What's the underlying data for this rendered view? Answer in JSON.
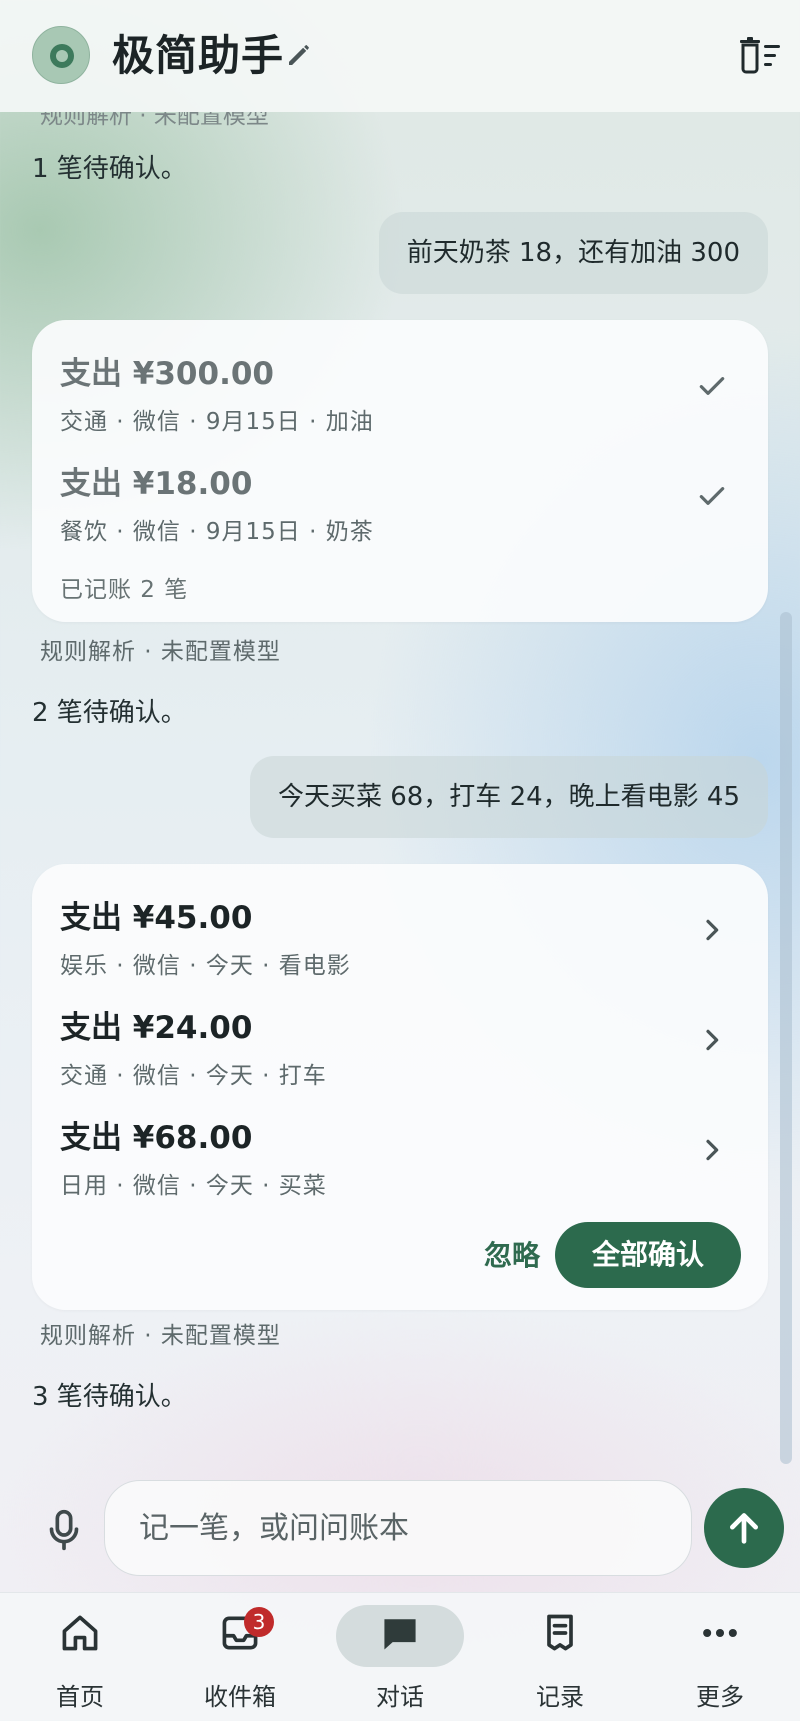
{
  "header": {
    "title": "极简助手"
  },
  "chat": {
    "peek_text": "规则解析 · 未配置模型",
    "messages": [
      {
        "type": "assistant_text",
        "text": "1 笔待确认。"
      },
      {
        "type": "user",
        "text": "前天奶茶 18，还有加油 300"
      },
      {
        "type": "card",
        "entries": [
          {
            "amount": "支出 ¥300.00",
            "detail": "交通 · 微信 · 9月15日 · 加油",
            "status": "confirmed"
          },
          {
            "amount": "支出 ¥18.00",
            "detail": "餐饮 · 微信 · 9月15日 · 奶茶",
            "status": "confirmed"
          }
        ],
        "note": "已记账 2 笔"
      },
      {
        "type": "meta",
        "text": "规则解析 · 未配置模型"
      },
      {
        "type": "assistant_text",
        "text": "2 笔待确认。"
      },
      {
        "type": "user",
        "text": "今天买菜 68，打车 24，晚上看电影 45"
      },
      {
        "type": "card",
        "entries": [
          {
            "amount": "支出 ¥45.00",
            "detail": "娱乐 · 微信 · 今天 · 看电影",
            "status": "pending"
          },
          {
            "amount": "支出 ¥24.00",
            "detail": "交通 · 微信 · 今天 · 打车",
            "status": "pending"
          },
          {
            "amount": "支出 ¥68.00",
            "detail": "日用 · 微信 · 今天 · 买菜",
            "status": "pending"
          }
        ],
        "ignore_label": "忽略",
        "confirm_all_label": "全部确认"
      },
      {
        "type": "meta",
        "text": "规则解析 · 未配置模型"
      },
      {
        "type": "assistant_text",
        "text": "3 笔待确认。"
      }
    ]
  },
  "composer": {
    "placeholder": "记一笔，或问问账本"
  },
  "nav": {
    "tabs": [
      {
        "label": "首页",
        "icon": "home-icon"
      },
      {
        "label": "收件箱",
        "icon": "inbox-icon",
        "badge": "3"
      },
      {
        "label": "对话",
        "icon": "chat-icon",
        "active": true
      },
      {
        "label": "记录",
        "icon": "receipt-icon"
      },
      {
        "label": "更多",
        "icon": "more-icon"
      }
    ]
  },
  "colors": {
    "accent": "#2c6a4d",
    "badge": "#c02b2b"
  }
}
